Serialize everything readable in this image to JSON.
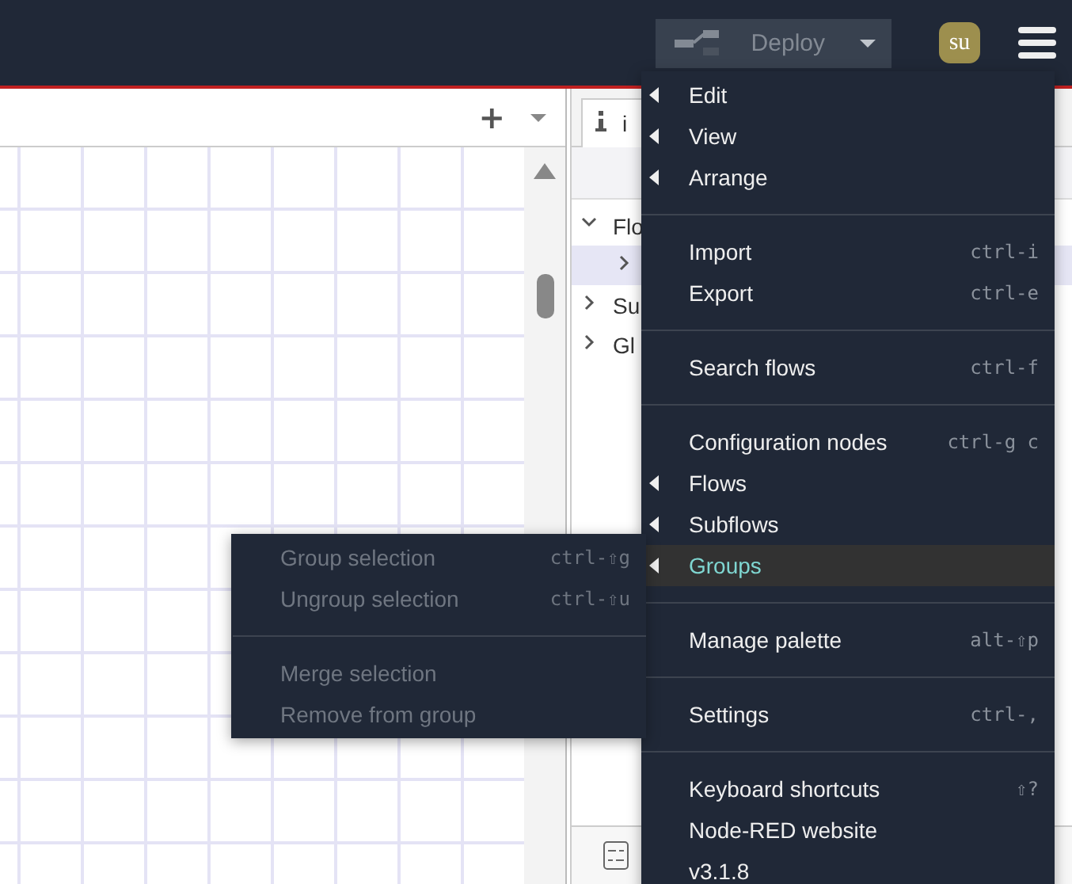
{
  "header": {
    "deploy": {
      "label": "Deploy",
      "disabled": true
    },
    "user": "su"
  },
  "workspace": {
    "tab_actions": [
      "+"
    ]
  },
  "sidebar": {
    "tab": {
      "label": "i",
      "selected": true
    },
    "tree": [
      {
        "label": "Flo",
        "expanded": true,
        "children": [
          {
            "selected": true
          }
        ]
      },
      {
        "label": "Su",
        "expanded": false
      },
      {
        "label": "Gl",
        "expanded": false
      }
    ]
  },
  "menu": [
    {
      "kind": "item",
      "label": "Edit",
      "submenu": true,
      "selected": false
    },
    {
      "kind": "item",
      "label": "View",
      "submenu": true,
      "selected": false
    },
    {
      "kind": "item",
      "label": "Arrange",
      "submenu": true,
      "selected": false
    },
    {
      "kind": "divider"
    },
    {
      "kind": "item",
      "label": "Import",
      "shortcut": "ctrl-i",
      "submenu": false,
      "selected": false
    },
    {
      "kind": "item",
      "label": "Export",
      "shortcut": "ctrl-e",
      "submenu": false,
      "selected": false
    },
    {
      "kind": "divider"
    },
    {
      "kind": "item",
      "label": "Search flows",
      "shortcut": "ctrl-f",
      "submenu": false,
      "selected": false
    },
    {
      "kind": "divider"
    },
    {
      "kind": "item",
      "label": "Configuration nodes",
      "shortcut": "ctrl-g c",
      "submenu": false,
      "selected": false
    },
    {
      "kind": "item",
      "label": "Flows",
      "submenu": true,
      "selected": false
    },
    {
      "kind": "item",
      "label": "Subflows",
      "submenu": true,
      "selected": false
    },
    {
      "kind": "item",
      "label": "Groups",
      "submenu": true,
      "selected": true
    },
    {
      "kind": "divider"
    },
    {
      "kind": "item",
      "label": "Manage palette",
      "shortcut": "alt-⇧p",
      "submenu": false,
      "selected": false
    },
    {
      "kind": "divider"
    },
    {
      "kind": "item",
      "label": "Settings",
      "shortcut": "ctrl-,",
      "submenu": false,
      "selected": false
    },
    {
      "kind": "divider"
    },
    {
      "kind": "item",
      "label": "Keyboard shortcuts",
      "shortcut": "⇧?",
      "submenu": false,
      "selected": false
    },
    {
      "kind": "item",
      "label": "Node-RED website",
      "submenu": false,
      "selected": false
    },
    {
      "kind": "item",
      "label": "v3.1.8",
      "submenu": false,
      "selected": false
    }
  ],
  "submenu": [
    {
      "kind": "item",
      "label": "Group selection",
      "shortcut": "ctrl-⇧g",
      "disabled": true
    },
    {
      "kind": "item",
      "label": "Ungroup selection",
      "shortcut": "ctrl-⇧u",
      "disabled": true
    },
    {
      "kind": "divider"
    },
    {
      "kind": "item",
      "label": "Merge selection",
      "disabled": true
    },
    {
      "kind": "item",
      "label": "Remove from group",
      "disabled": true
    }
  ]
}
